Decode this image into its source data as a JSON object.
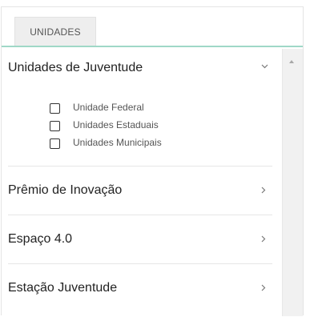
{
  "tabs": [
    {
      "label": "UNIDADES"
    }
  ],
  "accordion": {
    "sections": [
      {
        "title": "Unidades de Juventude",
        "expanded": true,
        "options": [
          {
            "label": "Unidade Federal",
            "checked": false
          },
          {
            "label": "Unidades Estaduais",
            "checked": false
          },
          {
            "label": "Unidades Municipais",
            "checked": false
          }
        ]
      },
      {
        "title": "Prêmio de Inovação",
        "expanded": false
      },
      {
        "title": "Espaço 4.0",
        "expanded": false
      },
      {
        "title": "Estação Juventude",
        "expanded": false
      }
    ]
  },
  "icons": {
    "expanded": "chevron-down-icon",
    "collapsed": "chevron-right-icon",
    "scroll_up": "scroll-up-arrow-icon"
  },
  "colors": {
    "tab_underline": "#9fd8c7",
    "tab_background": "#eeeeee",
    "text": "#222222",
    "option_text": "#555555"
  }
}
